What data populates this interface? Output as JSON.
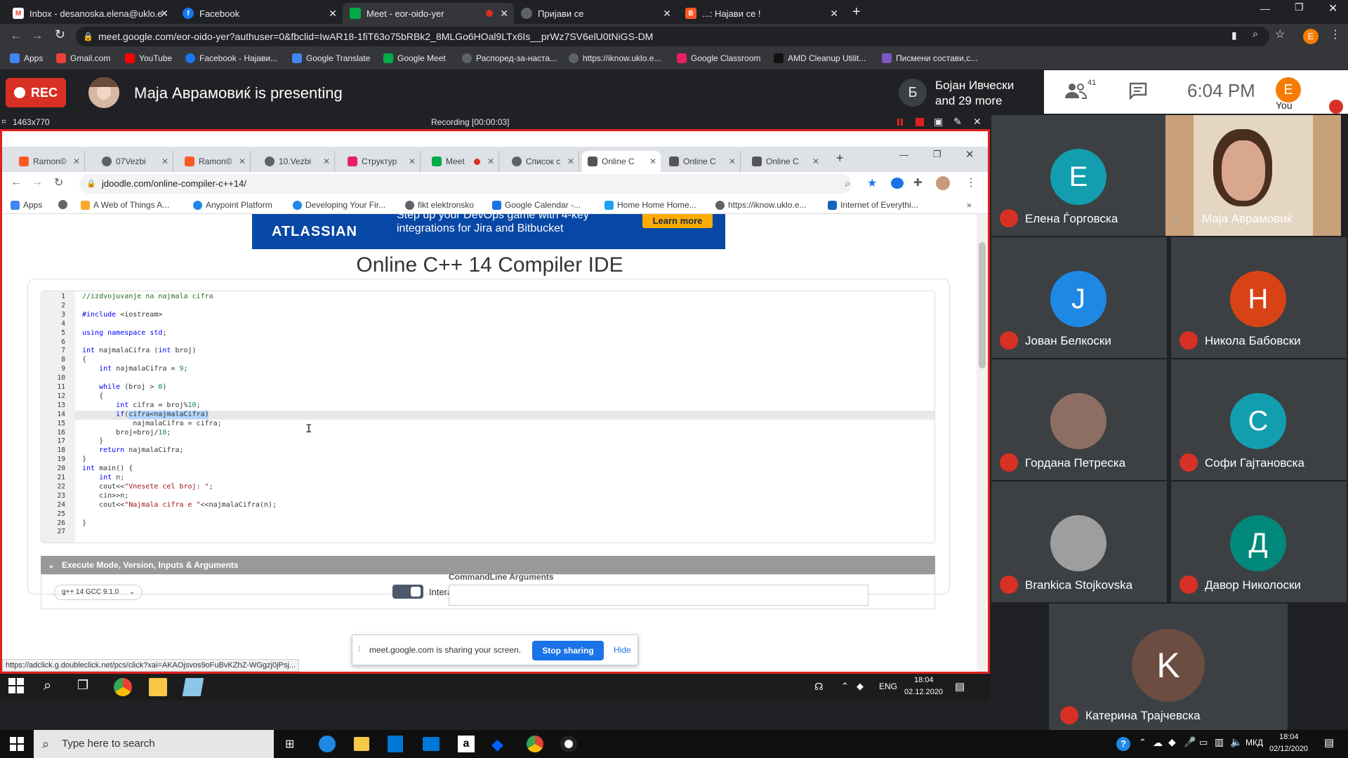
{
  "outer_browser": {
    "tabs": [
      {
        "title": "Inbox - desanoska.elena@uklo.e",
        "favicon_color": "#ea4335",
        "favicon_letter": "M"
      },
      {
        "title": "Facebook",
        "favicon_color": "#1877f2",
        "favicon_letter": "f"
      },
      {
        "title": "Meet - eor-oido-yer",
        "favicon_color": "#00ac47",
        "favicon_letter": ""
      },
      {
        "title": "Пријави се",
        "favicon_color": "#5f6368",
        "favicon_letter": ""
      },
      {
        "title": "...: Најави се !",
        "favicon_color": "#ff5722",
        "favicon_letter": "B"
      }
    ],
    "url": "meet.google.com/eor-oido-yer?authuser=0&fbclid=IwAR18-1fiT63o75bRBk2_8MLGo6HOal9LTx6Is__prWz7SV6elU0tNiGS-DM",
    "bookmarks": [
      "Apps",
      "Gmail.com",
      "YouTube",
      "Facebook - Најави...",
      "Google Translate",
      "Google Meet",
      "Распоред-за-наста...",
      "https://iknow.uklo.e...",
      "Google Classroom",
      "AMD Cleanup Utilit...",
      "Писмени состави,с..."
    ],
    "profile_letter": "E"
  },
  "meet": {
    "rec_label": "REC",
    "presenter_title": "Маја Аврамовиќ is presenting",
    "speaker_initial": "Б",
    "speaker_line1": "Бојан Ивчески",
    "speaker_line2": "and 29 more",
    "participants_count": "41",
    "time": "6:04 PM",
    "you_label": "You",
    "you_initial": "E"
  },
  "share_toolbar": {
    "resolution": "1463x770",
    "recording": "Recording [00:00:03]"
  },
  "inner_browser": {
    "tabs": [
      {
        "title": "Ramon©",
        "color": "#ff5722"
      },
      {
        "title": "07Vezbi",
        "color": "#5f6368"
      },
      {
        "title": "Ramon©",
        "color": "#ff5722"
      },
      {
        "title": "10.Vezbi",
        "color": "#5f6368"
      },
      {
        "title": "Структур",
        "color": "#e91e63"
      },
      {
        "title": "Meet",
        "color": "#00ac47"
      },
      {
        "title": "Список с",
        "color": "#5f6368"
      },
      {
        "title": "Online C",
        "color": "#555555"
      },
      {
        "title": "Online C",
        "color": "#555555"
      },
      {
        "title": "Online C",
        "color": "#555555"
      }
    ],
    "url": "jdoodle.com/online-compiler-c++14/",
    "bookmarks": [
      "Apps",
      "A Web of Things A...",
      "Anypoint Platform",
      "Developing Your Fir...",
      "fikt elektronsko",
      "Google Calendar -...",
      "Home Home Home...",
      "https://iknow.uklo.e...",
      "Internet of Everythi..."
    ]
  },
  "ad": {
    "brand": "ATLASSIAN",
    "text_line1": "Step up your DevOps game with 4-key",
    "text_line2": "integrations for Jira and Bitbucket",
    "button": "Learn more"
  },
  "ide": {
    "title": "Online C++ 14 Compiler IDE",
    "exec_bar": "Execute Mode, Version, Inputs & Arguments",
    "compiler": "g++ 14 GCC 9.1.0",
    "interactive_label": "Interactive",
    "cmdline_label": "CommandLine Arguments"
  },
  "code": [
    "//izdvojuvanje na najmala cifra",
    "",
    "#include <iostream>",
    "",
    "using namespace std;",
    "",
    "int najmalaCifra (int broj)",
    "{",
    "    int najmalaCifra = 9;",
    "",
    "    while (broj > 0)",
    "    {",
    "        int cifra = broj%10;",
    "        if(cifra<najmalaCifra)",
    "            najmalaCifra = cifra;",
    "        broj=broj/10;",
    "    }",
    "    return najmalaCifra;",
    "}",
    "int main() {",
    "    int n;",
    "    cout<<\"Vnesete cel broj: \";",
    "    cin>>n;",
    "    cout<<\"Najmala cifra e \"<<najmalaCifra(n);",
    "",
    "}",
    ""
  ],
  "share_notice": {
    "text": "meet.google.com is sharing your screen.",
    "stop": "Stop sharing",
    "hide": "Hide"
  },
  "status_url": "https://adclick.g.doubleclick.net/pcs/click?xai=AKAOjsvos9oFuBvKZhZ-WGgzj0jPsj...",
  "inner_taskbar": {
    "lang": "ENG",
    "time": "18:04",
    "date": "02.12.2020"
  },
  "participants": [
    {
      "name": "Елена Ѓорговска",
      "initial": "E",
      "color": "#129eaf",
      "muted": true
    },
    {
      "name": "Маја Аврамовиќ",
      "initial": "",
      "color": "#c8a07a",
      "muted": false
    },
    {
      "name": "Јован Белкоски",
      "initial": "J",
      "color": "#1e88e5",
      "muted": true
    },
    {
      "name": "Никола Бабовски",
      "initial": "H",
      "color": "#d84315",
      "muted": true
    },
    {
      "name": "Гордана Петреска",
      "initial": "",
      "color": "#8d6e63",
      "muted": true
    },
    {
      "name": "Софи Гајтановска",
      "initial": "C",
      "color": "#129eaf",
      "muted": true
    },
    {
      "name": "Brankica Stojkovska",
      "initial": "",
      "color": "#9e9e9e",
      "muted": true
    },
    {
      "name": "Давор Николоски",
      "initial": "Д",
      "color": "#00897b",
      "muted": true
    },
    {
      "name": "Катерина Трајчевска",
      "initial": "K",
      "color": "#6d4c41",
      "muted": true
    }
  ],
  "outer_taskbar": {
    "search_placeholder": "Type here to search",
    "lang": "МКД",
    "time": "18:04",
    "date": "02/12/2020"
  }
}
